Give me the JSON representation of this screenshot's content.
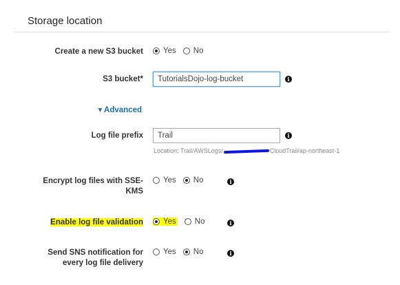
{
  "section": {
    "title": "Storage location"
  },
  "create_bucket": {
    "label": "Create a new S3 bucket",
    "yes": "Yes",
    "no": "No",
    "selected": "Yes"
  },
  "s3_bucket": {
    "label": "S3 bucket*",
    "value": "TutorialsDojo-log-bucket"
  },
  "advanced": {
    "label": "▾ Advanced"
  },
  "log_prefix": {
    "label": "Log file prefix",
    "value": "Trail",
    "location_prefix": "Location: Trail/AWSLogs/",
    "location_suffix": "CloudTrail/ap-northeast-1"
  },
  "encrypt": {
    "label_line1": "Encrypt log files with SSE-",
    "label_line2": "KMS",
    "yes": "Yes",
    "no": "No",
    "selected": "No"
  },
  "validation": {
    "label": "Enable log file validation",
    "yes": "Yes",
    "no": "No",
    "selected": "Yes"
  },
  "sns": {
    "label_line1": "Send SNS notification for",
    "label_line2": "every log file delivery",
    "yes": "Yes",
    "no": "No",
    "selected": "No"
  },
  "icons": {
    "info": "info-icon",
    "radio": "radio-icon"
  },
  "colors": {
    "highlight": "#ffff00",
    "link": "#1f6fb5",
    "focus": "#5b9dd9",
    "redaction": "#0f15e6"
  }
}
